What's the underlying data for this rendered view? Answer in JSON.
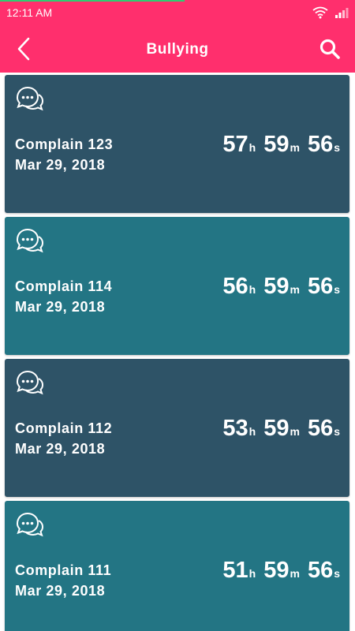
{
  "status_bar": {
    "time": "12:11 AM",
    "icons": [
      "wifi-icon",
      "signal-icon"
    ],
    "progress": 0.52
  },
  "app_bar": {
    "title": "Bullying",
    "back_icon": "chevron-left-icon",
    "search_icon": "search-icon"
  },
  "colors": {
    "accent": "#ff2f6d",
    "card_dark": "#2e5367",
    "card_teal": "#237584"
  },
  "complaints": [
    {
      "title": "Complain 123",
      "date": "Mar 29, 2018",
      "hours": "57",
      "minutes": "59",
      "seconds": "56",
      "color": "#2e5367"
    },
    {
      "title": "Complain 114",
      "date": "Mar 29, 2018",
      "hours": "56",
      "minutes": "59",
      "seconds": "56",
      "color": "#237584"
    },
    {
      "title": "Complain 112",
      "date": "Mar 29, 2018",
      "hours": "53",
      "minutes": "59",
      "seconds": "56",
      "color": "#2e5367"
    },
    {
      "title": "Complain 111",
      "date": "Mar 29, 2018",
      "hours": "51",
      "minutes": "59",
      "seconds": "56",
      "color": "#237584"
    }
  ],
  "timer_units": {
    "h": "h",
    "m": "m",
    "s": "s"
  }
}
